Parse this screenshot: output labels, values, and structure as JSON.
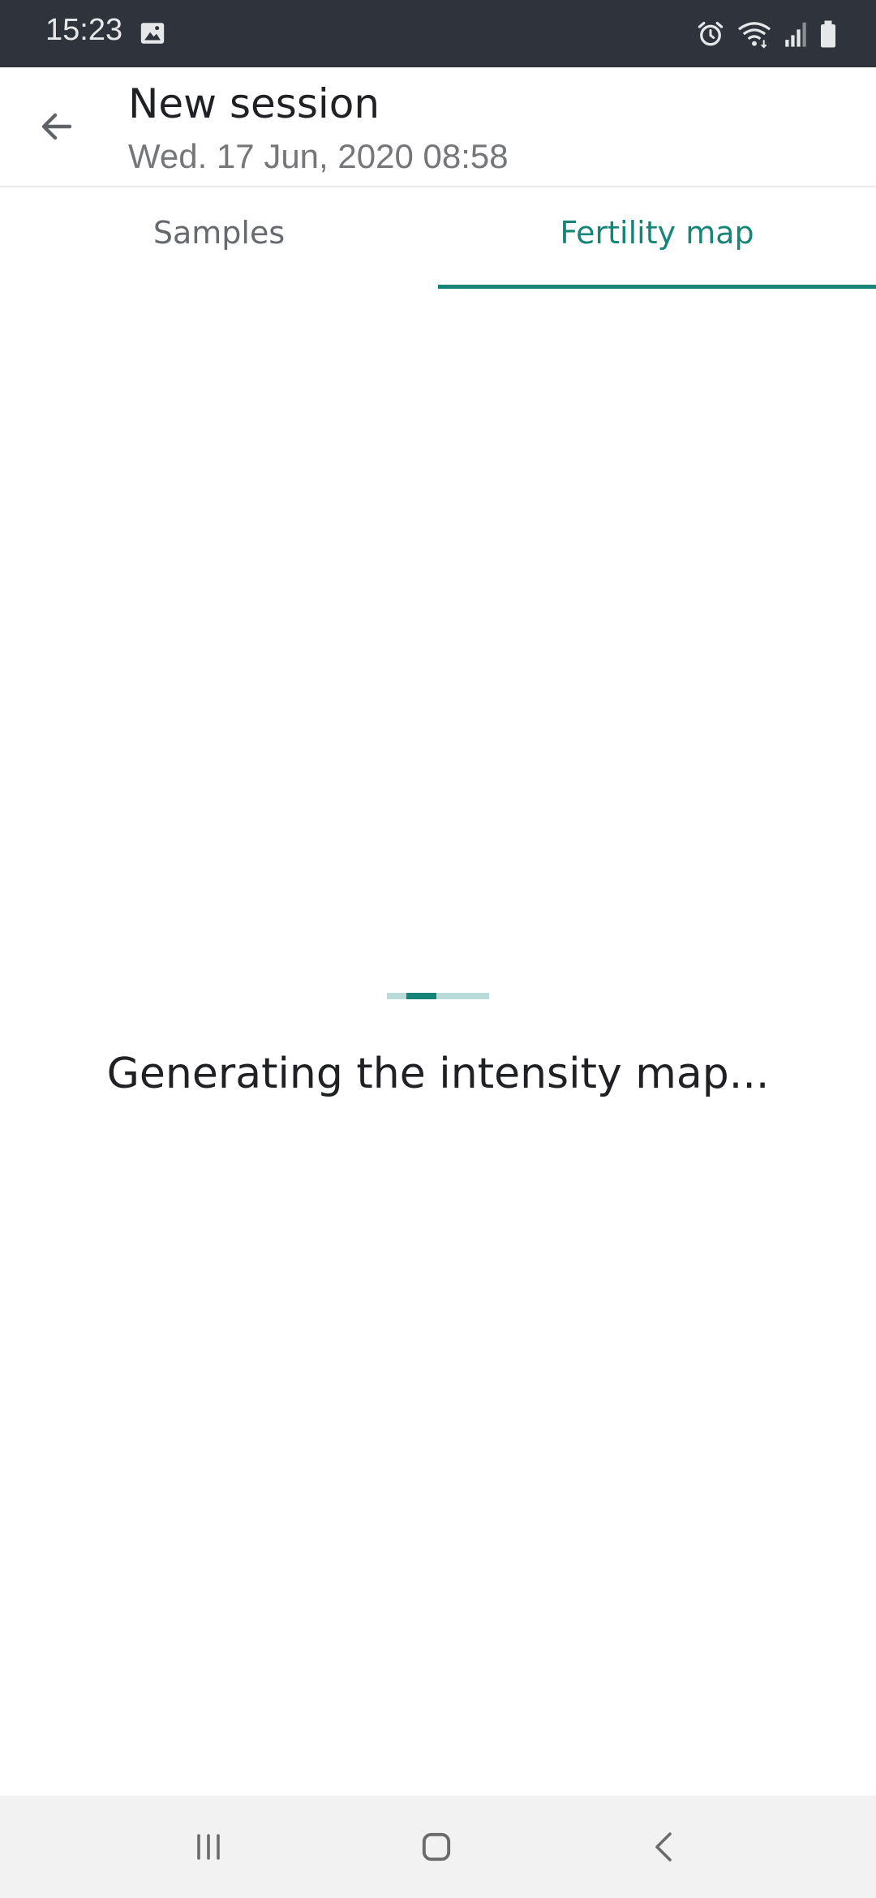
{
  "status_bar": {
    "time": "15:23",
    "icons": [
      "gallery-icon",
      "alarm-icon",
      "wifi-icon",
      "signal-icon",
      "battery-icon"
    ]
  },
  "app_bar": {
    "back_icon": "arrow-left-icon",
    "title": "New session",
    "subtitle": "Wed. 17 Jun, 2020 08:58"
  },
  "tabs": [
    {
      "label": "Samples",
      "selected": false
    },
    {
      "label": "Fertility map",
      "selected": true
    }
  ],
  "loading": {
    "message": "Generating the intensity map...",
    "progress_fraction": 0.29
  },
  "nav_bar": {
    "icons": [
      "recents-icon",
      "home-icon",
      "back-icon"
    ]
  },
  "colors": {
    "accent": "#168577",
    "accent_light": "#b9dcd8",
    "status_bar_bg": "#2f343c",
    "nav_bar_bg": "#f2f2f2"
  }
}
